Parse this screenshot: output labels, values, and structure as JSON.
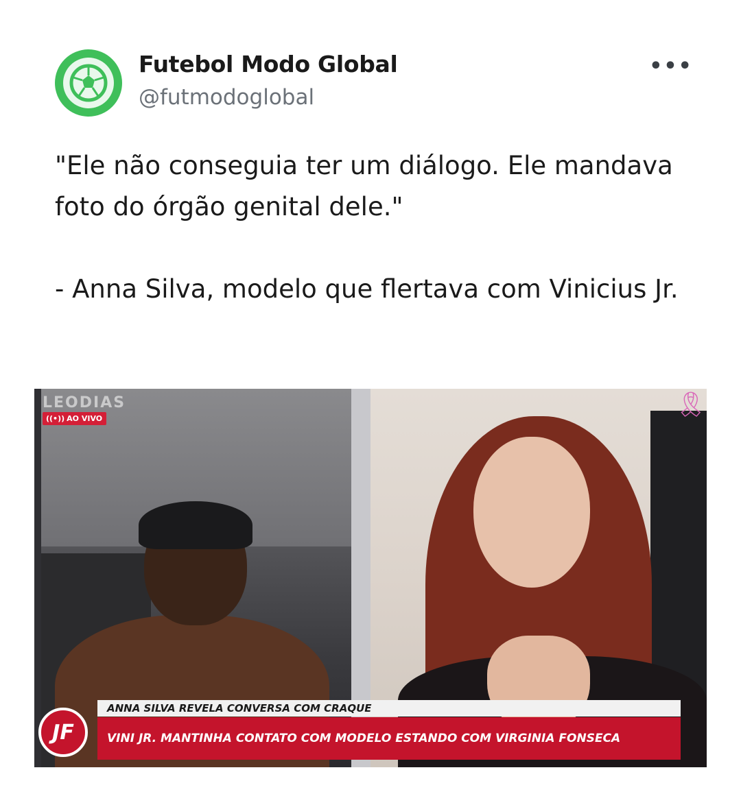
{
  "tweet": {
    "author": {
      "display_name": "Futebol Modo Global",
      "handle": "@futmodoglobal",
      "avatar_icon": "soccer-ball-icon",
      "avatar_color": "#3fbf5a"
    },
    "more_label": "•••",
    "text": {
      "quote": "\"Ele não conseguia ter um diálogo. Ele mandava foto do órgão genital dele.\"",
      "attribution": "- Anna Silva, modelo que flertava com Vinicius Jr."
    }
  },
  "media": {
    "channel_logo": "LEODIAS",
    "live_badge": "AO VIVO",
    "ribbon_icon": "awareness-ribbon-icon",
    "lower_third": {
      "logo": "JF",
      "headline_top": "ANNA SILVA REVELA CONVERSA COM CRAQUE",
      "headline_main": "VINI JR. MANTINHA CONTATO COM MODELO ESTANDO COM VIRGINIA FONSECA",
      "accent_color": "#c4142c"
    }
  }
}
